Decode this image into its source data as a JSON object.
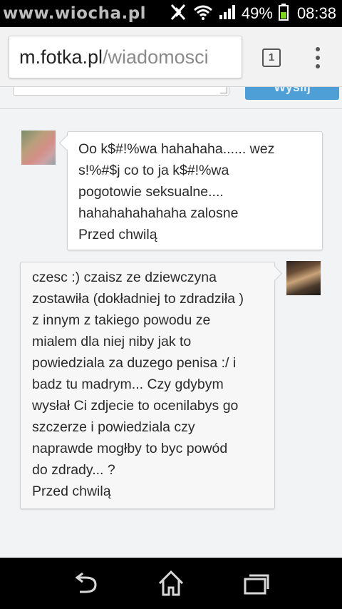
{
  "status_bar": {
    "watermark": "www.wiocha.pl",
    "battery_percent": "49%",
    "time": "08:38",
    "icons": [
      "nfc-icon",
      "wifi-icon",
      "signal-icon",
      "battery-icon"
    ]
  },
  "browser": {
    "url_host": "m.fotka.pl",
    "url_path": "/wiadomosci",
    "tab_count": "1",
    "menu_icon": "overflow-menu-icon"
  },
  "composer": {
    "send_label": "Wyślij"
  },
  "messages": [
    {
      "side": "left",
      "avatar": "user-avatar-female",
      "lines": [
        "Oo k$#!%wa hahahaha...... wez",
        "s!%#$j co to ja k$#!%wa",
        "pogotowie seksualne....",
        "hahahahahahaha zalosne"
      ],
      "timestamp": "Przed chwilą"
    },
    {
      "side": "right",
      "avatar": "user-avatar-male",
      "lines": [
        "czesc :) czaisz ze dziewczyna",
        "zostawiła (dokładniej to zdradziła )",
        "z innym z takiego powodu ze",
        "mialem dla niej niby jak to",
        "powiedziala za duzego penisa :/ i",
        "badz tu madrym... Czy gdybym",
        "wysłał Ci zdjecie to ocenilabys go",
        "szczerze i powiedziala czy",
        "naprawde mogłby to byc powód",
        "do zdrady... ?"
      ],
      "timestamp": "Przed chwilą"
    }
  ],
  "nav_bar": {
    "buttons": [
      "back-icon",
      "home-icon",
      "recent-apps-icon"
    ]
  },
  "colors": {
    "send_button": "#4d9fd6",
    "page_background": "#f2f3f5",
    "status_bar": "#000000"
  }
}
